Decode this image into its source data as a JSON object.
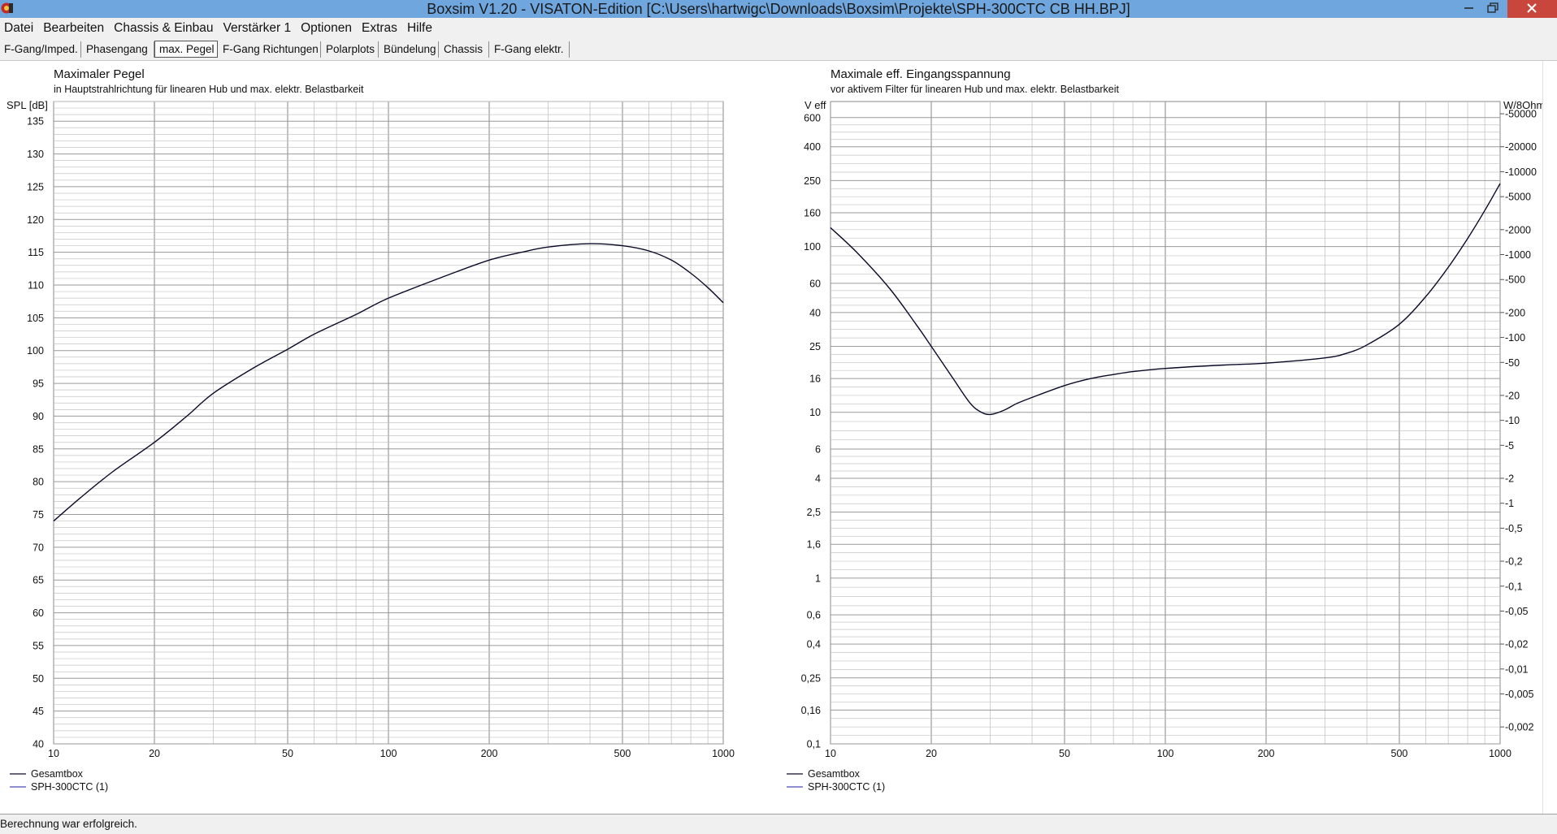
{
  "window": {
    "title": "Boxsim V1.20 - VISATON-Edition [C:\\Users\\hartwigc\\Downloads\\Boxsim\\Projekte\\SPH-300CTC CB HH.BPJ]",
    "app_icon": "boxsim-logo-icon",
    "controls": [
      "minimize-icon",
      "maximize-icon",
      "close-icon"
    ]
  },
  "menu": [
    "Datei",
    "Bearbeiten",
    "Chassis & Einbau",
    "Verstärker 1",
    "Optionen",
    "Extras",
    "Hilfe"
  ],
  "tabs": [
    {
      "label": "F-Gang/Imped.",
      "active": false
    },
    {
      "label": "Phasengang",
      "active": false
    },
    {
      "label": "max. Pegel",
      "active": true
    },
    {
      "label": "F-Gang Richtungen",
      "active": false
    },
    {
      "label": "Polarplots",
      "active": false
    },
    {
      "label": "Bündelung",
      "active": false
    },
    {
      "label": "Chassis",
      "active": false
    },
    {
      "label": "F-Gang elektr.",
      "active": false
    }
  ],
  "status": "Berechnung war erfolgreich.",
  "colors": {
    "titlebar": "#6fa6de",
    "close": "#c9463d",
    "curve": "#0a0a28",
    "legend_series2": "#4a4ab4",
    "grid": "#c4c4c4"
  },
  "chart_data": [
    {
      "type": "line",
      "title": "Maximaler Pegel",
      "subtitle": "in Hauptstrahlrichtung für linearen Hub und max. elektr. Belastbarkeit",
      "ylabel": "SPL [dB]",
      "x_scale": "log",
      "xlim": [
        10,
        1000
      ],
      "ylim": [
        40,
        138
      ],
      "x_ticks": [
        10,
        20,
        50,
        100,
        200,
        500,
        1000
      ],
      "y_ticks": [
        40,
        45,
        50,
        55,
        60,
        65,
        70,
        75,
        80,
        85,
        90,
        95,
        100,
        105,
        110,
        115,
        120,
        125,
        130,
        135
      ],
      "grid": true,
      "legend": [
        "Gesamtbox",
        "SPH-300CTC (1)"
      ],
      "legend_position": "bottom-left",
      "series": [
        {
          "name": "Gesamtbox",
          "x": [
            10,
            12,
            15,
            20,
            25,
            30,
            40,
            50,
            60,
            80,
            100,
            150,
            200,
            250,
            300,
            400,
            500,
            600,
            700,
            800,
            900,
            1000
          ],
          "y": [
            74,
            77.5,
            81.5,
            86,
            90,
            93.5,
            97.5,
            100.2,
            102.5,
            105.5,
            108,
            111.5,
            113.8,
            115,
            115.8,
            116.3,
            116.0,
            115.2,
            113.8,
            111.8,
            109.6,
            107.3
          ]
        }
      ]
    },
    {
      "type": "line",
      "title": "Maximale eff. Eingangsspannung",
      "subtitle": "vor aktivem Filter für linearen Hub und max. elektr. Belastbarkeit",
      "ylabel": "V eff",
      "y2label": "W/8Ohm",
      "x_scale": "log",
      "y_scale": "log",
      "xlim": [
        10,
        1000
      ],
      "ylim": [
        0.1,
        750
      ],
      "x_ticks": [
        10,
        20,
        50,
        100,
        200,
        500,
        1000
      ],
      "y_ticks": [
        {
          "v": 0.1,
          "label": "0,1"
        },
        {
          "v": 0.16,
          "label": "0,16"
        },
        {
          "v": 0.25,
          "label": "0,25"
        },
        {
          "v": 0.4,
          "label": "0,4"
        },
        {
          "v": 0.6,
          "label": "0,6"
        },
        {
          "v": 1,
          "label": "1"
        },
        {
          "v": 1.6,
          "label": "1,6"
        },
        {
          "v": 2.5,
          "label": "2,5"
        },
        {
          "v": 4,
          "label": "4"
        },
        {
          "v": 6,
          "label": "6"
        },
        {
          "v": 10,
          "label": "10"
        },
        {
          "v": 16,
          "label": "16"
        },
        {
          "v": 25,
          "label": "25"
        },
        {
          "v": 40,
          "label": "40"
        },
        {
          "v": 60,
          "label": "60"
        },
        {
          "v": 100,
          "label": "100"
        },
        {
          "v": 160,
          "label": "160"
        },
        {
          "v": 250,
          "label": "250"
        },
        {
          "v": 400,
          "label": "400"
        },
        {
          "v": 600,
          "label": "600"
        }
      ],
      "y2_ticks": [
        {
          "w": 0.002,
          "label": "0,002"
        },
        {
          "w": 0.005,
          "label": "0,005"
        },
        {
          "w": 0.01,
          "label": "0,01"
        },
        {
          "w": 0.02,
          "label": "0,02"
        },
        {
          "w": 0.05,
          "label": "0,05"
        },
        {
          "w": 0.1,
          "label": "0,1"
        },
        {
          "w": 0.2,
          "label": "0,2"
        },
        {
          "w": 0.5,
          "label": "0,5"
        },
        {
          "w": 1,
          "label": "1"
        },
        {
          "w": 2,
          "label": "2"
        },
        {
          "w": 5,
          "label": "5"
        },
        {
          "w": 10,
          "label": "10"
        },
        {
          "w": 20,
          "label": "20"
        },
        {
          "w": 50,
          "label": "50"
        },
        {
          "w": 100,
          "label": "100"
        },
        {
          "w": 200,
          "label": "200"
        },
        {
          "w": 500,
          "label": "500"
        },
        {
          "w": 1000,
          "label": "1000"
        },
        {
          "w": 2000,
          "label": "2000"
        },
        {
          "w": 5000,
          "label": "5000"
        },
        {
          "w": 10000,
          "label": "10000"
        },
        {
          "w": 20000,
          "label": "20000"
        },
        {
          "w": 50000,
          "label": "50000"
        }
      ],
      "grid": true,
      "legend": [
        "Gesamtbox",
        "SPH-300CTC (1)"
      ],
      "legend_position": "bottom-left",
      "series": [
        {
          "name": "Gesamtbox",
          "x": [
            10,
            12,
            15,
            18,
            20,
            23,
            26,
            28,
            30,
            33,
            36,
            40,
            50,
            60,
            70,
            80,
            100,
            150,
            200,
            300,
            350,
            400,
            500,
            600,
            700,
            800,
            900,
            1000
          ],
          "y": [
            130,
            92,
            56,
            34,
            25,
            16.5,
            11.5,
            10.1,
            9.7,
            10.3,
            11.3,
            12.3,
            14.5,
            16.0,
            16.9,
            17.6,
            18.4,
            19.3,
            19.8,
            21.3,
            22.8,
            25.5,
            34,
            50,
            75,
            112,
            165,
            240
          ]
        }
      ]
    }
  ]
}
